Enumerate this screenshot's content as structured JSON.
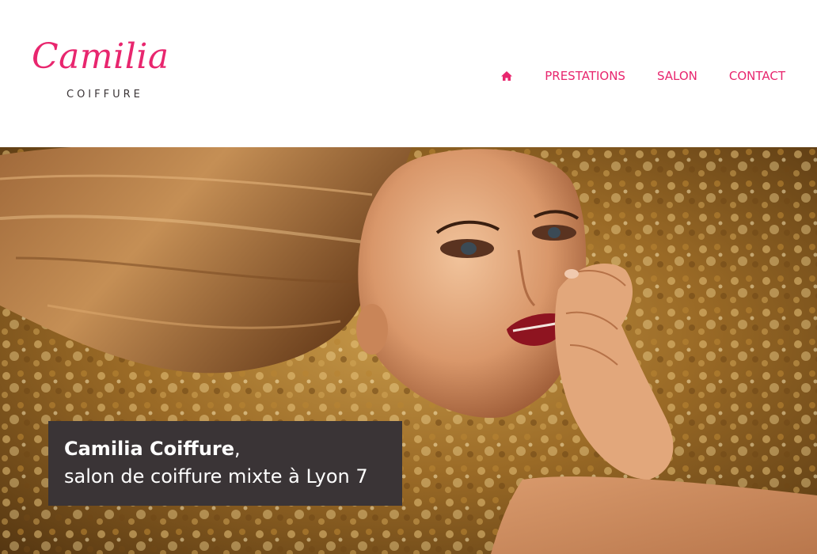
{
  "brand": {
    "name": "Camilia",
    "tagline": "COIFFURE"
  },
  "nav": {
    "home_icon": "home-icon",
    "items": [
      {
        "label": "PRESTATIONS"
      },
      {
        "label": "SALON"
      },
      {
        "label": "CONTACT"
      }
    ]
  },
  "hero": {
    "title": "Camilia Coiffure",
    "title_suffix": ",",
    "subtitle": "salon de coiffure mixte à Lyon 7"
  },
  "colors": {
    "accent": "#e8266e",
    "caption_bg": "#3a3436",
    "text_dark": "#3a3436"
  }
}
